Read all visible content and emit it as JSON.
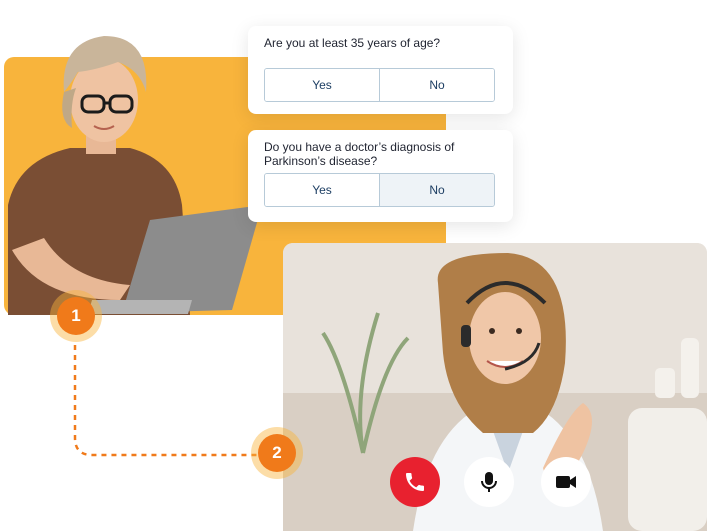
{
  "questions": [
    {
      "text": "Are you at least 35 years of age?",
      "yes_label": "Yes",
      "no_label": "No",
      "selected": "none"
    },
    {
      "text": "Do you have a doctor’s diagnosis of Parkinson’s disease?",
      "yes_label": "Yes",
      "no_label": "No",
      "selected": "No"
    }
  ],
  "steps": [
    "1",
    "2"
  ],
  "call_controls": [
    "end-call",
    "microphone",
    "video-camera"
  ],
  "colors": {
    "panel_orange": "#f8b43c",
    "step_orange": "#f07a1a",
    "end_call_red": "#e8212f",
    "answer_text": "#1d3e63"
  }
}
